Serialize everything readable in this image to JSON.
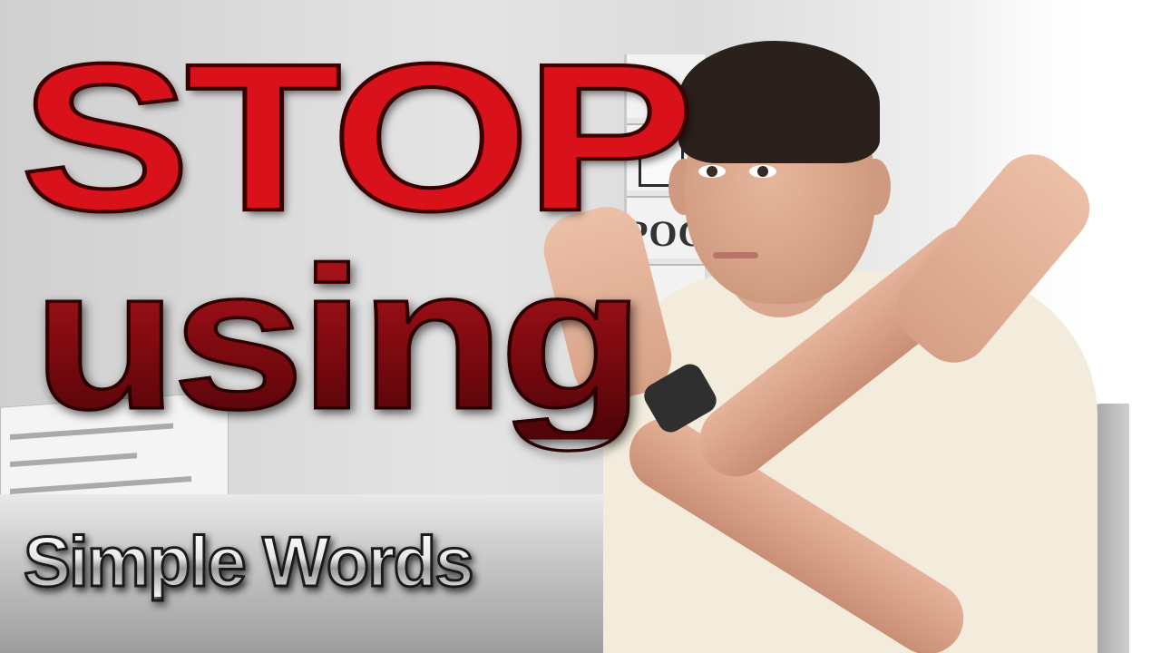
{
  "thumbnail": {
    "headline_line1": "STOP",
    "headline_line2": "using",
    "subheadline": "Simple Words",
    "shelf_text": "POC",
    "colors": {
      "headline_red": "#d9111a",
      "headline_dark_red": "#8e0f16",
      "subheadline_silver": "#e9e9e9",
      "sweater": "#f3ecdc"
    }
  }
}
